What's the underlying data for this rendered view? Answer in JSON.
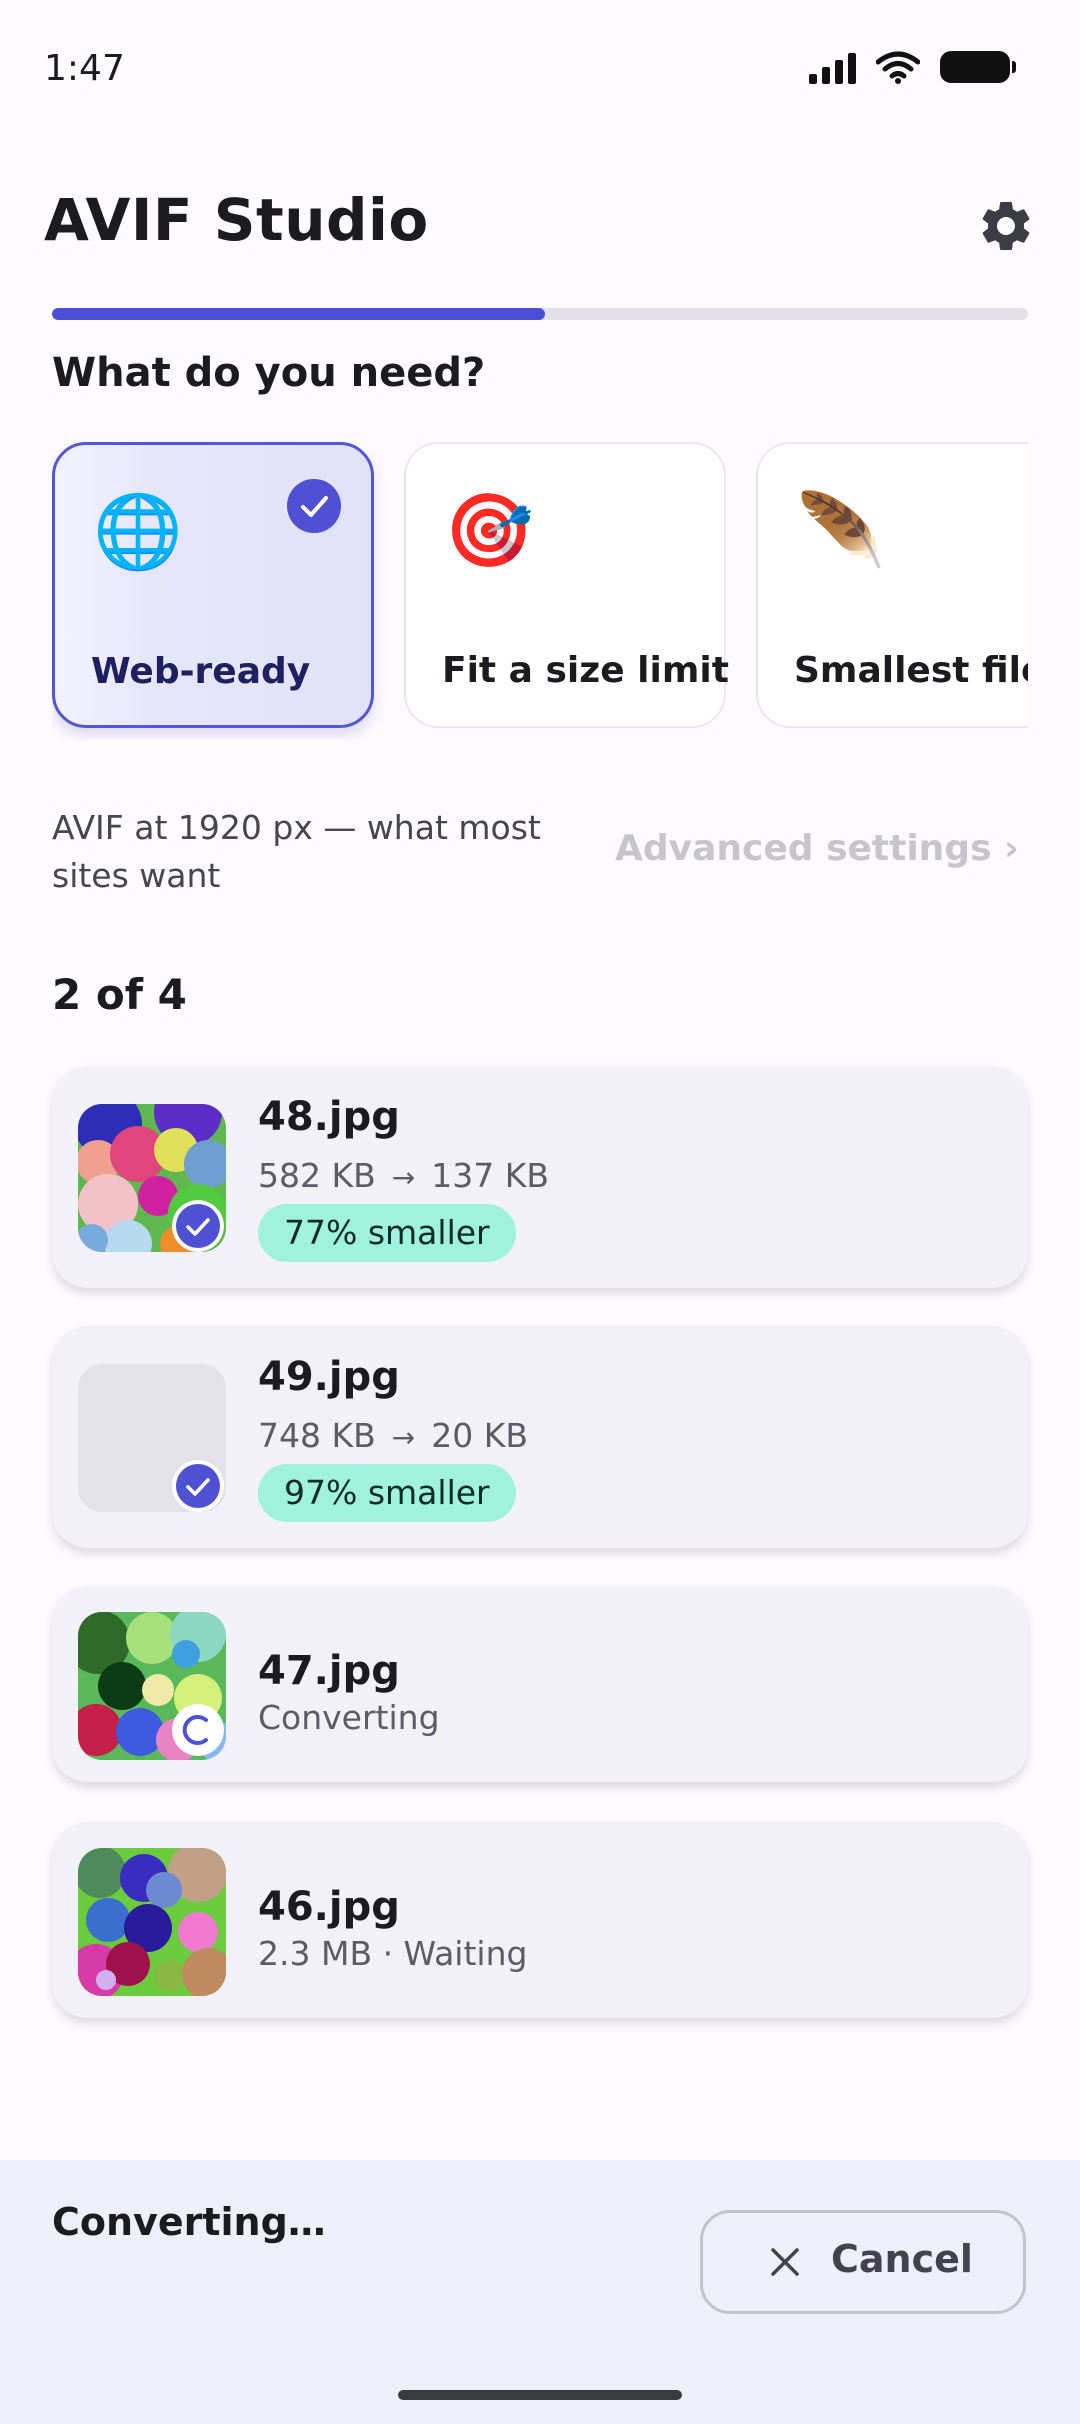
{
  "status_bar": {
    "time": "1:47"
  },
  "header": {
    "title": "AVIF Studio",
    "settings_icon": "gear-icon"
  },
  "progress": {
    "fraction": 0.505,
    "color": "#4a4fd6"
  },
  "presets": {
    "heading": "What do you need?",
    "items": [
      {
        "label": "Web-ready",
        "emoji": "🌐",
        "selected": true
      },
      {
        "label": "Fit a size limit",
        "emoji": "🎯",
        "selected": false
      },
      {
        "label": "Smallest file",
        "emoji": "🪶",
        "selected": false
      }
    ],
    "description": "AVIF at 1920 px — what most sites want",
    "advanced_label": "Advanced settings  ›"
  },
  "files": {
    "count_label": "2 of 4",
    "items": [
      {
        "name": "48.jpg",
        "from_size": "582 KB",
        "arrow": "→",
        "to_size": "137 KB",
        "badge": "77% smaller",
        "state": "done"
      },
      {
        "name": "49.jpg",
        "from_size": "748 KB",
        "arrow": "→",
        "to_size": "20 KB",
        "badge": "97% smaller",
        "state": "done"
      },
      {
        "name": "47.jpg",
        "status": "Converting",
        "state": "converting"
      },
      {
        "name": "46.jpg",
        "status": "2.3 MB · Waiting",
        "state": "waiting"
      }
    ]
  },
  "bottom_bar": {
    "status": "Converting…",
    "cancel_label": "Cancel"
  },
  "colors": {
    "accent": "#4e52d2",
    "savings_pill": "#9ff2dc",
    "card_bg": "#f2f1f8"
  }
}
